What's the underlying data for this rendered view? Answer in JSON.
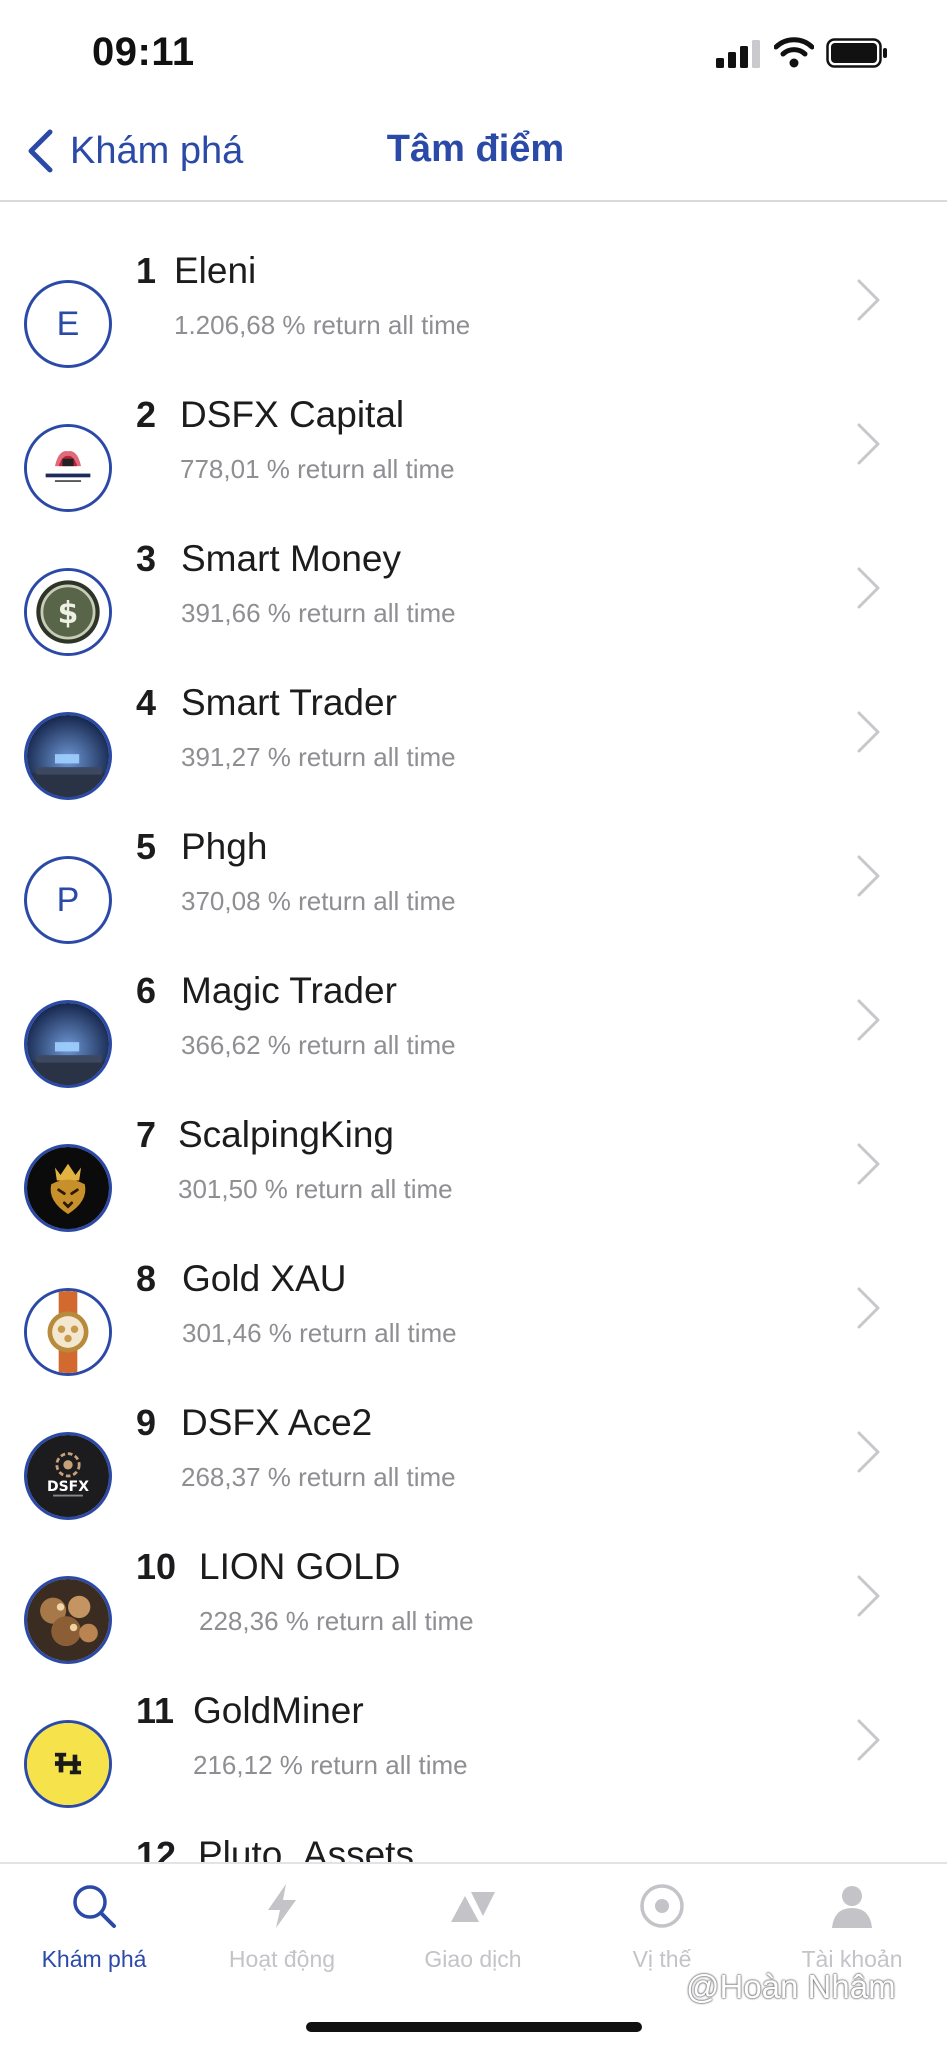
{
  "status_bar": {
    "time": "09:11"
  },
  "nav": {
    "back_label": "Khám phá",
    "title": "Tâm điểm"
  },
  "traders": [
    {
      "rank": "1",
      "name": "Eleni",
      "return": "1.206,68 % return all time",
      "avatar": "letter",
      "avatar_letter": "E"
    },
    {
      "rank": "2",
      "name": "DSFX Capital",
      "return": "778,01 % return all time",
      "avatar": "dsfx-capital-logo"
    },
    {
      "rank": "3",
      "name": "Smart Money",
      "return": "391,66 % return all time",
      "avatar": "dollar-coin-logo"
    },
    {
      "rank": "4",
      "name": "Smart Trader",
      "return": "391,27 % return all time",
      "avatar": "night-sky-photo"
    },
    {
      "rank": "5",
      "name": "Phgh",
      "return": "370,08 % return all time",
      "avatar": "letter",
      "avatar_letter": "P"
    },
    {
      "rank": "6",
      "name": "Magic Trader",
      "return": "366,62 % return all time",
      "avatar": "night-sky-photo"
    },
    {
      "rank": "7",
      "name": "ScalpingKing",
      "return": "301,50 % return all time",
      "avatar": "lion-crown-logo"
    },
    {
      "rank": "8",
      "name": "Gold XAU",
      "return": "301,46 % return all time",
      "avatar": "gold-watch-photo"
    },
    {
      "rank": "9",
      "name": "DSFX Ace2",
      "return": "268,37 % return all time",
      "avatar": "dsfx-axitrader-logo"
    },
    {
      "rank": "10",
      "name": "LION GOLD",
      "return": "228,36 % return all time",
      "avatar": "gold-nuggets-photo"
    },
    {
      "rank": "11",
      "name": "GoldMiner",
      "return": "216,12 % return all time",
      "avatar": "yellow-h-logo"
    },
    {
      "rank": "12",
      "name": "Pluto_Assets",
      "return": "",
      "avatar": "partial"
    }
  ],
  "tabs": [
    {
      "label": "Khám phá",
      "icon": "search-icon",
      "active": true
    },
    {
      "label": "Hoạt động",
      "icon": "lightning-icon",
      "active": false
    },
    {
      "label": "Giao dịch",
      "icon": "trade-triangles-icon",
      "active": false
    },
    {
      "label": "Vị thế",
      "icon": "position-target-icon",
      "active": false
    },
    {
      "label": "Tài khoản",
      "icon": "account-person-icon",
      "active": false
    }
  ],
  "watermark": "@Hoàn Nhâm",
  "colors": {
    "accent": "#2b4aa8",
    "text": "#1c1c1e",
    "secondary": "#8e8e93",
    "inactive_tab": "#c3c3c8",
    "chevron": "#c7c7cc"
  }
}
